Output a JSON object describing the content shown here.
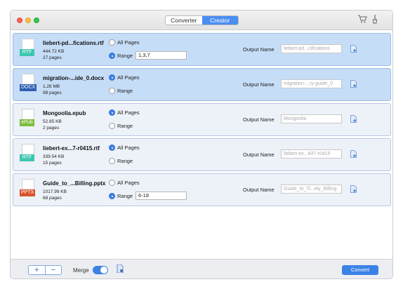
{
  "window": {
    "tabs": [
      {
        "label": "Converter",
        "active": false
      },
      {
        "label": "Creator",
        "active": true
      }
    ],
    "toolbar_icons": [
      "cart-icon",
      "brush-icon"
    ]
  },
  "files": [
    {
      "type_tag": "RTF",
      "tag_color": "#3cc6b0",
      "name": "liebert-pd...fications.rtf",
      "size": "444.72 KB",
      "pages": "27 pages",
      "all_pages_label": "All Pages",
      "range_label": "Range",
      "mode": "range",
      "range_value": "1,3,7",
      "output_label": "Output Name",
      "output_placeholder": "liebert-pd...cifications",
      "selected": true
    },
    {
      "type_tag": "DOCX",
      "tag_color": "#2f5fb3",
      "name": "migration-...ide_0.docx",
      "size": "1.28 MB",
      "pages": "98 pages",
      "all_pages_label": "All Pages",
      "range_label": "Range",
      "mode": "all",
      "range_value": "",
      "output_label": "Output Name",
      "output_placeholder": "migration-...ry-guide_0",
      "selected": true
    },
    {
      "type_tag": "ePub",
      "tag_color": "#7cbd3e",
      "name": "Mongoolia.epub",
      "size": "52.85 KB",
      "pages": "2 pages",
      "all_pages_label": "All Pages",
      "range_label": "Range",
      "mode": "all",
      "range_value": "",
      "output_label": "Output Name",
      "output_placeholder": "Mongoolia",
      "selected": false
    },
    {
      "type_tag": "RTF",
      "tag_color": "#3cc6b0",
      "name": "liebert-ex...7-r0415.rtf",
      "size": "339.54 KB",
      "pages": "15 pages",
      "all_pages_label": "All Pages",
      "range_label": "Range",
      "mode": "all",
      "range_value": "",
      "output_label": "Output Name",
      "output_placeholder": "liebert-ex...647-r0415",
      "selected": false
    },
    {
      "type_tag": "PPTX",
      "tag_color": "#d9532c",
      "name": "Guide_to_...Billing.pptx",
      "size": "1017.99 KB",
      "pages": "68 pages",
      "all_pages_label": "All Pages",
      "range_label": "Range",
      "mode": "range",
      "range_value": "6-18",
      "output_label": "Output Name",
      "output_placeholder": "Guide_to_Ti...ely_Billing",
      "selected": false
    }
  ],
  "bottom": {
    "add_label": "+",
    "remove_label": "−",
    "merge_label": "Merge",
    "merge_on": true,
    "convert_label": "Convert"
  },
  "colors": {
    "accent": "#3b82e6",
    "row_selected": "#c6ddf7",
    "row_default": "#edf1f8"
  }
}
